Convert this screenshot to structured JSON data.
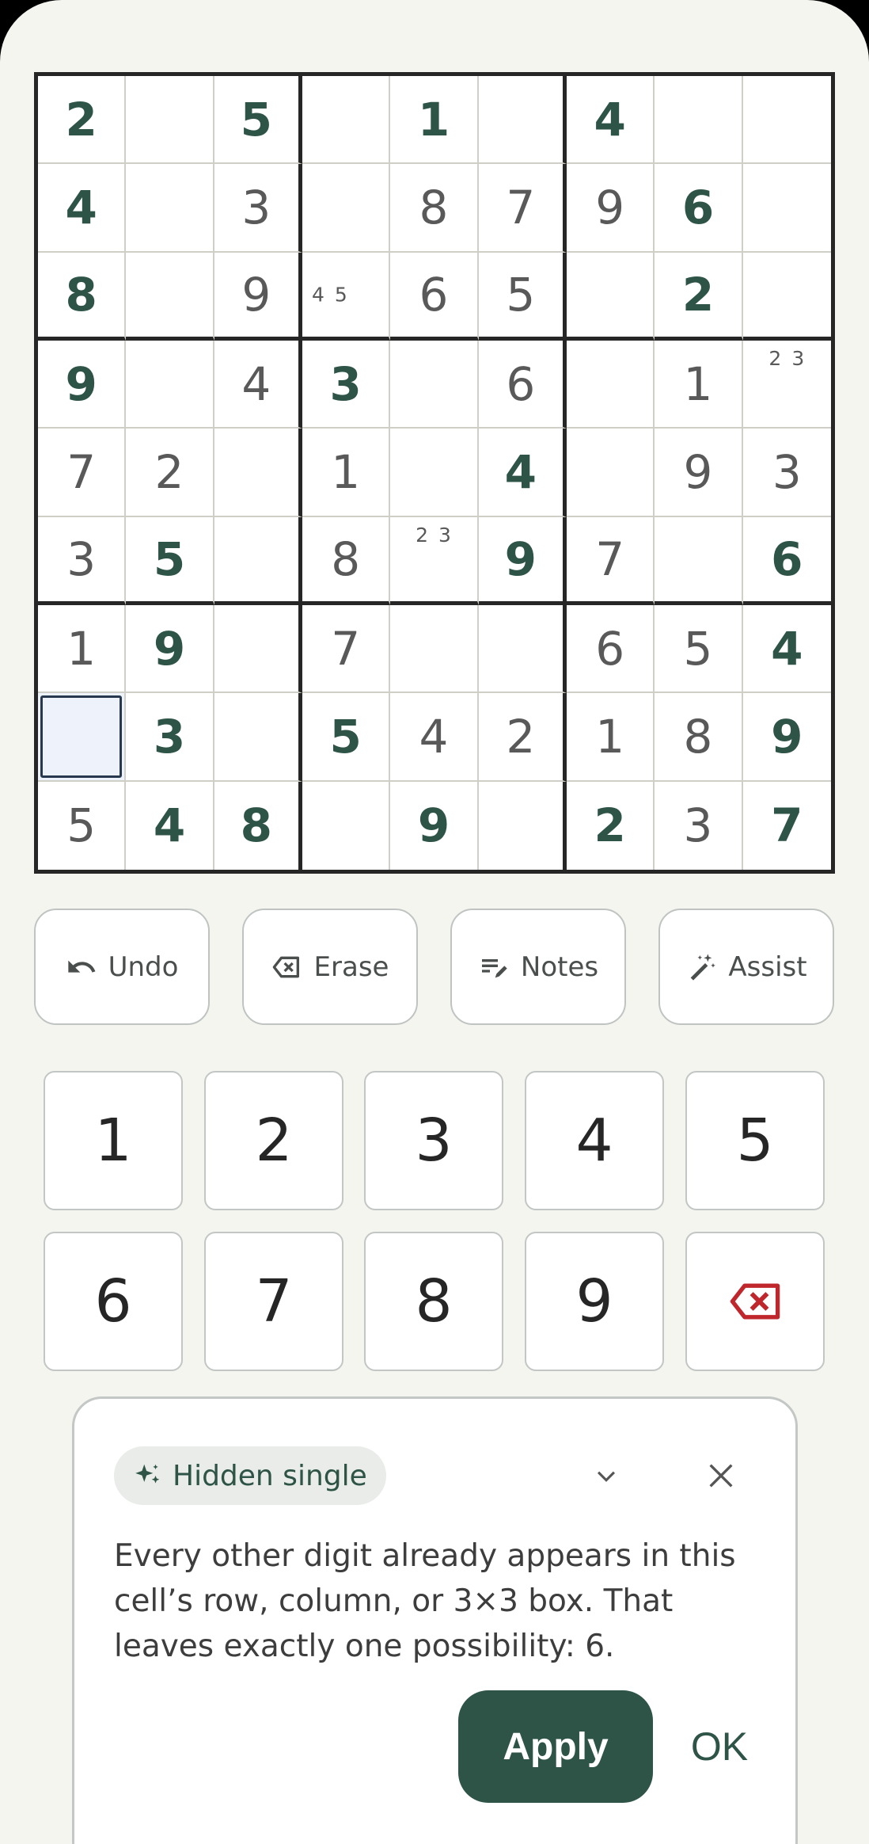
{
  "board": {
    "rows": [
      [
        {
          "v": "2",
          "t": "user"
        },
        {
          "v": "",
          "t": "empty"
        },
        {
          "v": "5",
          "t": "user"
        },
        {
          "v": "",
          "t": "empty"
        },
        {
          "v": "1",
          "t": "user"
        },
        {
          "v": "",
          "t": "empty"
        },
        {
          "v": "4",
          "t": "user"
        },
        {
          "v": "",
          "t": "empty"
        },
        {
          "v": "",
          "t": "empty"
        }
      ],
      [
        {
          "v": "4",
          "t": "user"
        },
        {
          "v": "",
          "t": "empty"
        },
        {
          "v": "3",
          "t": "given"
        },
        {
          "v": "",
          "t": "empty"
        },
        {
          "v": "8",
          "t": "given"
        },
        {
          "v": "7",
          "t": "given"
        },
        {
          "v": "9",
          "t": "given"
        },
        {
          "v": "6",
          "t": "user"
        },
        {
          "v": "",
          "t": "empty"
        }
      ],
      [
        {
          "v": "8",
          "t": "user"
        },
        {
          "v": "",
          "t": "empty"
        },
        {
          "v": "9",
          "t": "given"
        },
        {
          "v": "",
          "t": "notes",
          "n": [
            "4",
            "5"
          ],
          "pos": "left"
        },
        {
          "v": "6",
          "t": "given"
        },
        {
          "v": "5",
          "t": "given"
        },
        {
          "v": "",
          "t": "empty"
        },
        {
          "v": "2",
          "t": "user"
        },
        {
          "v": "",
          "t": "empty"
        }
      ],
      [
        {
          "v": "9",
          "t": "user"
        },
        {
          "v": "",
          "t": "empty"
        },
        {
          "v": "4",
          "t": "given"
        },
        {
          "v": "3",
          "t": "user"
        },
        {
          "v": "",
          "t": "empty"
        },
        {
          "v": "6",
          "t": "given"
        },
        {
          "v": "",
          "t": "empty"
        },
        {
          "v": "1",
          "t": "given"
        },
        {
          "v": "",
          "t": "notes",
          "n": [
            "2",
            "3"
          ],
          "pos": "top"
        }
      ],
      [
        {
          "v": "7",
          "t": "given"
        },
        {
          "v": "2",
          "t": "given"
        },
        {
          "v": "",
          "t": "empty"
        },
        {
          "v": "1",
          "t": "given"
        },
        {
          "v": "",
          "t": "empty"
        },
        {
          "v": "4",
          "t": "user"
        },
        {
          "v": "",
          "t": "empty"
        },
        {
          "v": "9",
          "t": "given"
        },
        {
          "v": "3",
          "t": "given"
        }
      ],
      [
        {
          "v": "3",
          "t": "given"
        },
        {
          "v": "5",
          "t": "user"
        },
        {
          "v": "",
          "t": "empty"
        },
        {
          "v": "8",
          "t": "given"
        },
        {
          "v": "",
          "t": "notes",
          "n": [
            "2",
            "3"
          ],
          "pos": "top"
        },
        {
          "v": "9",
          "t": "user"
        },
        {
          "v": "7",
          "t": "given"
        },
        {
          "v": "",
          "t": "empty"
        },
        {
          "v": "6",
          "t": "user"
        }
      ],
      [
        {
          "v": "1",
          "t": "given"
        },
        {
          "v": "9",
          "t": "user"
        },
        {
          "v": "",
          "t": "empty"
        },
        {
          "v": "7",
          "t": "given"
        },
        {
          "v": "",
          "t": "empty"
        },
        {
          "v": "",
          "t": "empty"
        },
        {
          "v": "6",
          "t": "given"
        },
        {
          "v": "5",
          "t": "given"
        },
        {
          "v": "4",
          "t": "user"
        }
      ],
      [
        {
          "v": "",
          "t": "selected"
        },
        {
          "v": "3",
          "t": "user"
        },
        {
          "v": "",
          "t": "empty"
        },
        {
          "v": "5",
          "t": "user"
        },
        {
          "v": "4",
          "t": "given"
        },
        {
          "v": "2",
          "t": "given"
        },
        {
          "v": "1",
          "t": "given"
        },
        {
          "v": "8",
          "t": "given"
        },
        {
          "v": "9",
          "t": "user"
        }
      ],
      [
        {
          "v": "5",
          "t": "given"
        },
        {
          "v": "4",
          "t": "user"
        },
        {
          "v": "8",
          "t": "user"
        },
        {
          "v": "",
          "t": "empty"
        },
        {
          "v": "9",
          "t": "user"
        },
        {
          "v": "",
          "t": "empty"
        },
        {
          "v": "2",
          "t": "user"
        },
        {
          "v": "3",
          "t": "given"
        },
        {
          "v": "7",
          "t": "user"
        }
      ]
    ]
  },
  "toolbar": {
    "undo_label": "Undo",
    "erase_label": "Erase",
    "notes_label": "Notes",
    "assist_label": "Assist"
  },
  "keypad": {
    "digits": [
      "1",
      "2",
      "3",
      "4",
      "5",
      "6",
      "7",
      "8",
      "9"
    ],
    "delete_icon": "backspace-icon"
  },
  "hint": {
    "chip_label": "Hidden single",
    "chip_icon": "sparkle-icon",
    "body": "Every other digit already appears in this cell’s row, column, or 3×3 box. That leaves exactly one possibility: 6.",
    "apply_label": "Apply",
    "ok_label": "OK"
  },
  "colors": {
    "accent": "#2d5446",
    "given_digit": "#595959",
    "delete_icon": "#c0272d",
    "selected_cell": "#eef3fb"
  }
}
